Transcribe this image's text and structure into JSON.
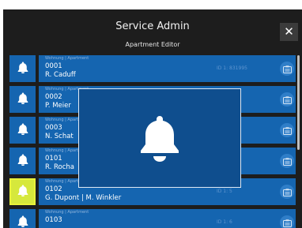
{
  "header": {
    "title": "Service Admin",
    "subtitle": "Apartment Editor",
    "close_label": "✕"
  },
  "apartments": [
    {
      "label": "Wohnung | Apartment",
      "number": "0001",
      "name": "R. Caduff",
      "id": "ID 1: 831995",
      "highlighted": false
    },
    {
      "label": "Wohnung | Apartment",
      "number": "0002",
      "name": "P. Meier",
      "id": "",
      "highlighted": false
    },
    {
      "label": "Wohnung | Apartment",
      "number": "0003",
      "name": "N. Schat",
      "id": "",
      "highlighted": false
    },
    {
      "label": "Wohnung | Apartment",
      "number": "0101",
      "name": "R. Rocha",
      "id": "",
      "highlighted": false
    },
    {
      "label": "Wohnung | Apartment",
      "number": "0102",
      "name": "G. Dupont | M. Winkler",
      "id": "ID 1: 5",
      "highlighted": true
    },
    {
      "label": "Wohnung | Apartment",
      "number": "0103",
      "name": "",
      "id": "ID 1: 6",
      "highlighted": false
    }
  ],
  "icons": {
    "bell": "bell-icon",
    "edit": "edit-card-icon",
    "close": "close-icon"
  },
  "colors": {
    "row_background": "#1565b0",
    "highlight": "#d6e83c",
    "overlay": "#0f4e8e",
    "panel": "#1d1d1d"
  }
}
